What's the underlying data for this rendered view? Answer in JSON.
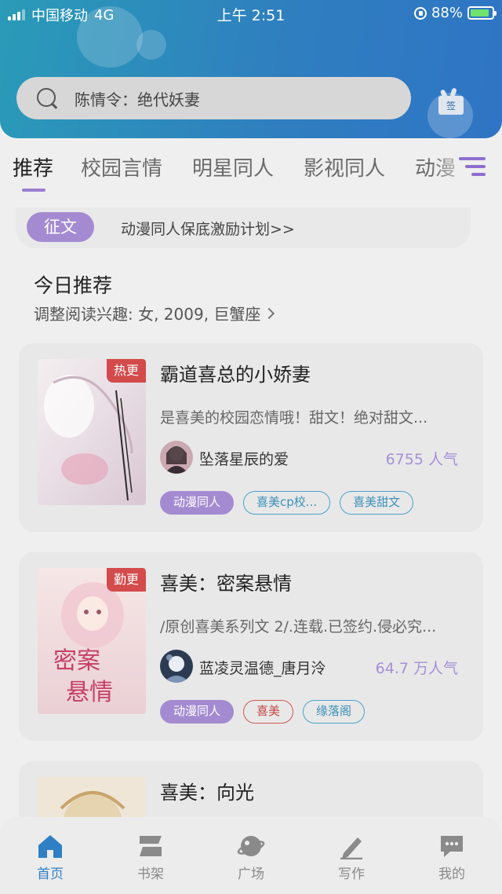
{
  "status_bar": {
    "carrier": "中国移动",
    "network": "4G",
    "time": "上午 2:51",
    "battery": "88%"
  },
  "search": {
    "placeholder": "陈情令：绝代妖妻"
  },
  "sign_button": {
    "label": "签"
  },
  "tabs": [
    {
      "label": "推荐",
      "active": true
    },
    {
      "label": "校园言情"
    },
    {
      "label": "明星同人"
    },
    {
      "label": "影视同人"
    },
    {
      "label": "动漫"
    }
  ],
  "banner": {
    "badge": "征文",
    "text": "动漫同人保底激励计划>>"
  },
  "section": {
    "title": "今日推荐",
    "subtitle": "调整阅读兴趣: 女, 2009, 巨蟹座"
  },
  "books": [
    {
      "badge": "热更",
      "title": "霸道喜总的小娇妻",
      "description": "是喜美的校园恋情哦！甜文！绝对甜文...",
      "author": "坠落星辰的爱",
      "popularity": "6755 人气",
      "tags": [
        {
          "label": "动漫同人",
          "style": "purple"
        },
        {
          "label": "喜美cp校...",
          "style": "blue"
        },
        {
          "label": "喜美甜文",
          "style": "blue"
        }
      ]
    },
    {
      "badge": "勤更",
      "title": "喜美：密案悬情",
      "description": "/原创喜美系列文 2/.连载.已签约.侵必究...",
      "author": "蓝凌灵温德_唐月泠",
      "popularity": "64.7 万人气",
      "tags": [
        {
          "label": "动漫同人",
          "style": "purple"
        },
        {
          "label": "喜美",
          "style": "red"
        },
        {
          "label": "缘落阁",
          "style": "blue"
        }
      ]
    },
    {
      "title": "喜美：向光"
    }
  ],
  "bottom_nav": [
    {
      "label": "首页",
      "icon": "home-icon",
      "active": true
    },
    {
      "label": "书架",
      "icon": "bookshelf-icon"
    },
    {
      "label": "广场",
      "icon": "planet-icon"
    },
    {
      "label": "写作",
      "icon": "pen-icon"
    },
    {
      "label": "我的",
      "icon": "chat-bubble-icon"
    }
  ],
  "colors": {
    "header": "#2f7fbf",
    "accent_purple": "#a48bd1",
    "tag_blue": "#4ba3c9",
    "tag_red": "#d35656",
    "badge_red": "#d34b4b",
    "nav_active": "#2f7fc4"
  }
}
